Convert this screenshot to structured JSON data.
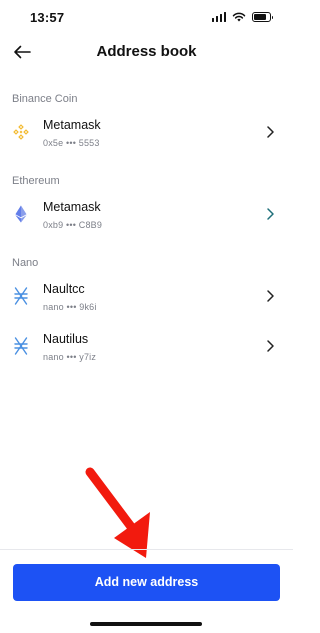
{
  "status_bar": {
    "time": "13:57",
    "icons": [
      "signal-icon",
      "wifi-icon",
      "battery-icon"
    ]
  },
  "header": {
    "title": "Address book",
    "back_icon": "arrow-left-icon"
  },
  "sections": [
    {
      "label": "Binance Coin",
      "items": [
        {
          "name": "Metamask",
          "address": "0x5e ••• 5553",
          "icon": "binance-coin-icon",
          "accent": "#F3BA2F"
        }
      ]
    },
    {
      "label": "Ethereum",
      "items": [
        {
          "name": "Metamask",
          "address": "0xb9 ••• C8B9",
          "icon": "ethereum-icon",
          "accent": "#627EEA"
        }
      ]
    },
    {
      "label": "Nano",
      "items": [
        {
          "name": "Naultcc",
          "address": "nano ••• 9k6i",
          "icon": "nano-icon",
          "accent": "#4A90E2"
        },
        {
          "name": "Nautilus",
          "address": "nano ••• y7iz",
          "icon": "nano-icon",
          "accent": "#4A90E2"
        }
      ]
    }
  ],
  "footer": {
    "add_button_label": "Add new address",
    "button_color": "#1D52F4"
  },
  "annotation": {
    "icon": "red-arrow-icon",
    "color": "#F21A0E"
  }
}
